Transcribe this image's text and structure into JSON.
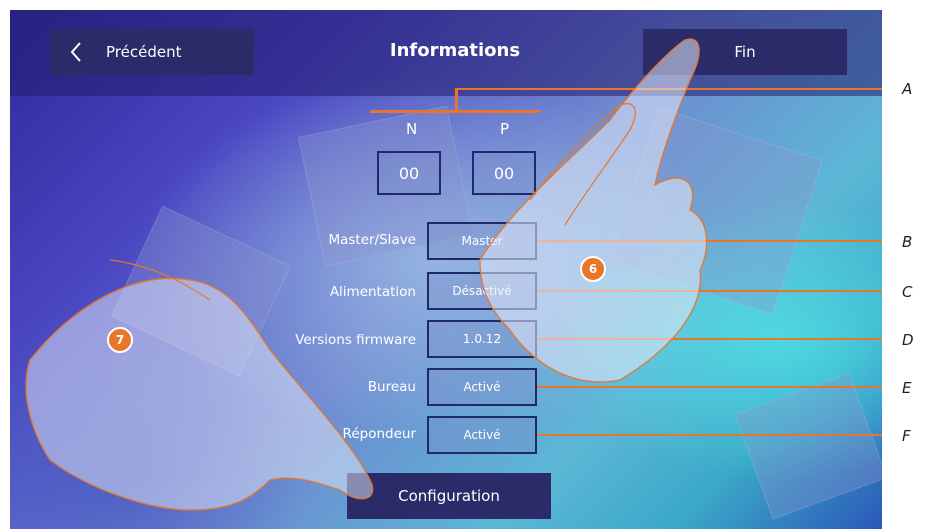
{
  "header": {
    "back_label": "Précédent",
    "title": "Informations",
    "done_label": "Fin",
    "back_icon": "chevron-left-icon"
  },
  "address": {
    "n_label": "N",
    "p_label": "P",
    "n_value": "00",
    "p_value": "00"
  },
  "rows": [
    {
      "label": "Master/Slave",
      "value": "Master",
      "callout": "B"
    },
    {
      "label": "Alimentation",
      "value": "Désactivé",
      "callout": "C"
    },
    {
      "label": "Versions firmware",
      "value": "1.0.12",
      "callout": "D"
    },
    {
      "label": "Bureau",
      "value": "Activé",
      "callout": "E"
    },
    {
      "label": "Répondeur",
      "value": "Activé",
      "callout": "F"
    }
  ],
  "callout_a": "A",
  "config_label": "Configuration",
  "steps": {
    "first": "6",
    "second": "7"
  },
  "colors": {
    "accent": "#e8762a",
    "button": "#2b2b6a"
  }
}
